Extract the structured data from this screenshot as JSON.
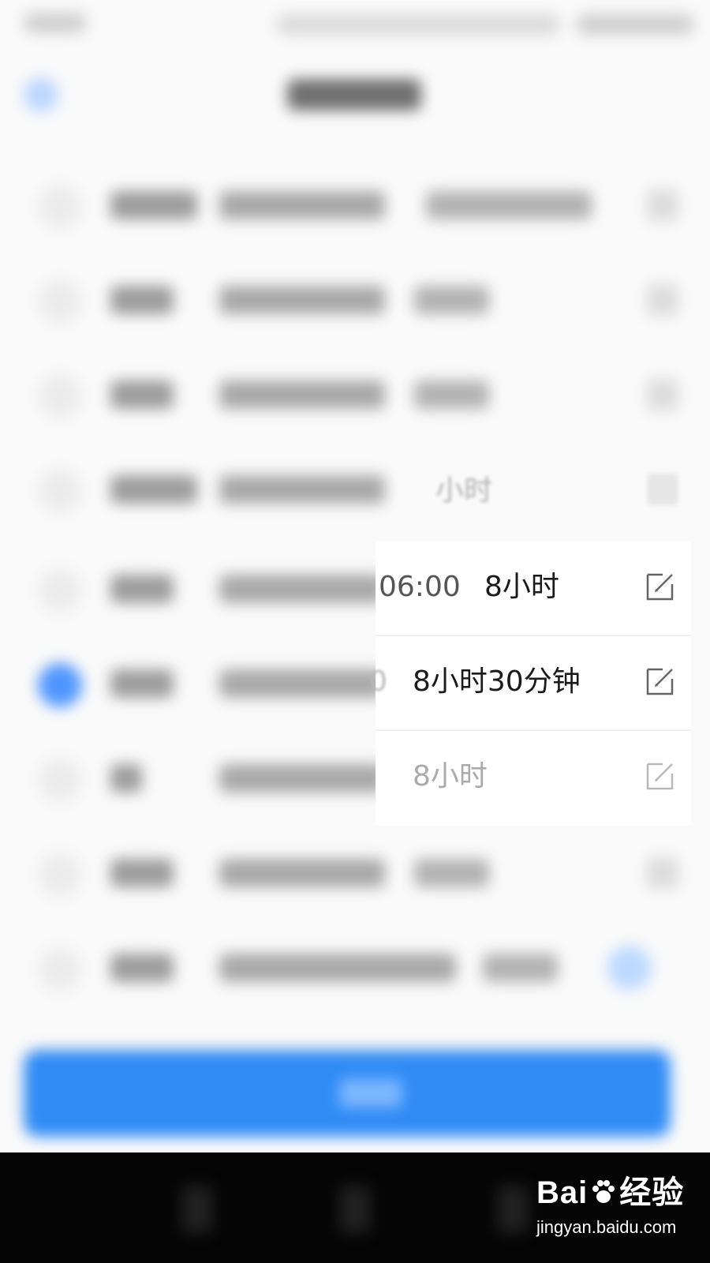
{
  "schedule_rows": [
    {
      "time_end": "06:00",
      "duration": "8小时"
    },
    {
      "time_end": "0",
      "duration": "8小时30分钟"
    },
    {
      "duration": "8小时"
    }
  ],
  "partial_duration": "小时",
  "watermark": {
    "brand": "Bai",
    "brand_tail": "经验",
    "url": "jingyan.baidu.com"
  },
  "colors": {
    "accent": "#2f8bf5",
    "radio_selected": "#4f95ff"
  },
  "icons": {
    "edit": "edit-icon",
    "back": "back-icon",
    "paw": "paw-icon"
  }
}
